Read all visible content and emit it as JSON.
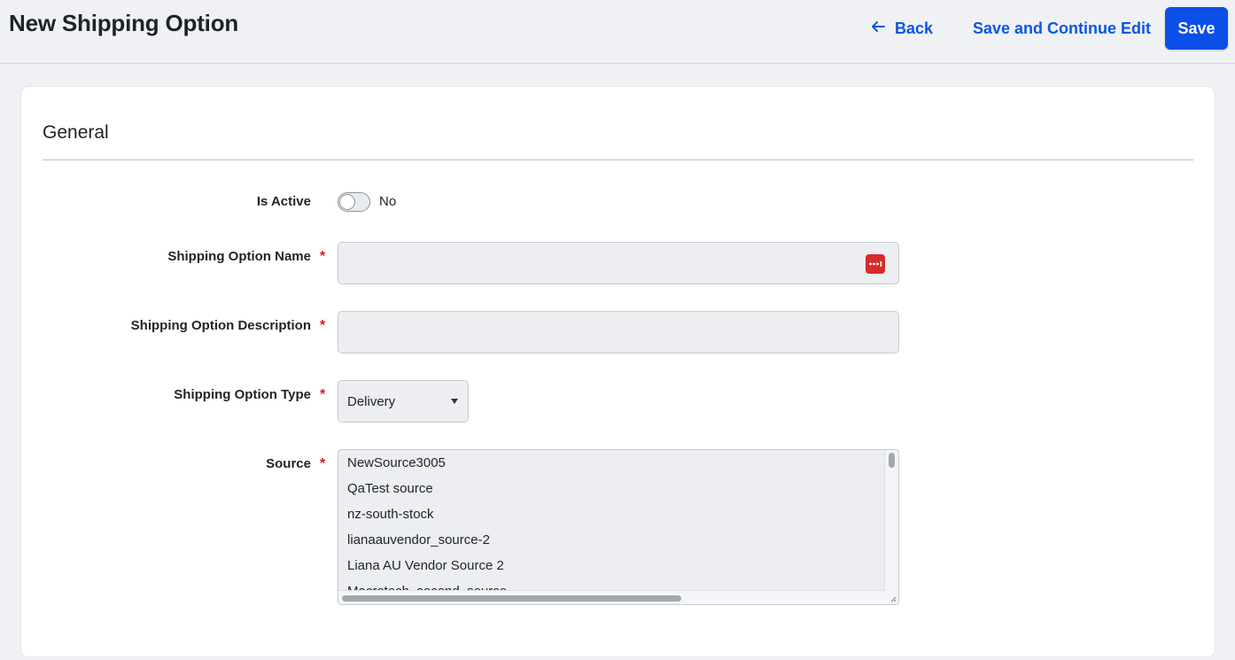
{
  "header": {
    "title": "New Shipping Option",
    "back_label": "Back",
    "save_continue_label": "Save and Continue Edit",
    "save_label": "Save",
    "accent_color": "#0a56e6"
  },
  "general": {
    "section_title": "General",
    "is_active": {
      "label": "Is Active",
      "value": "No",
      "checked": false
    },
    "name": {
      "label": "Shipping Option Name",
      "required_mark": "*",
      "value": ""
    },
    "description": {
      "label": "Shipping Option Description",
      "required_mark": "*",
      "value": ""
    },
    "type": {
      "label": "Shipping Option Type",
      "required_mark": "*",
      "selected": "Delivery"
    },
    "source": {
      "label": "Source",
      "required_mark": "*",
      "options": [
        "NewSource3005",
        "QaTest source",
        "nz-south-stock",
        "lianaauvendor_source-2",
        "Liana AU Vendor Source 2",
        "Macrotech_second_source"
      ]
    }
  }
}
